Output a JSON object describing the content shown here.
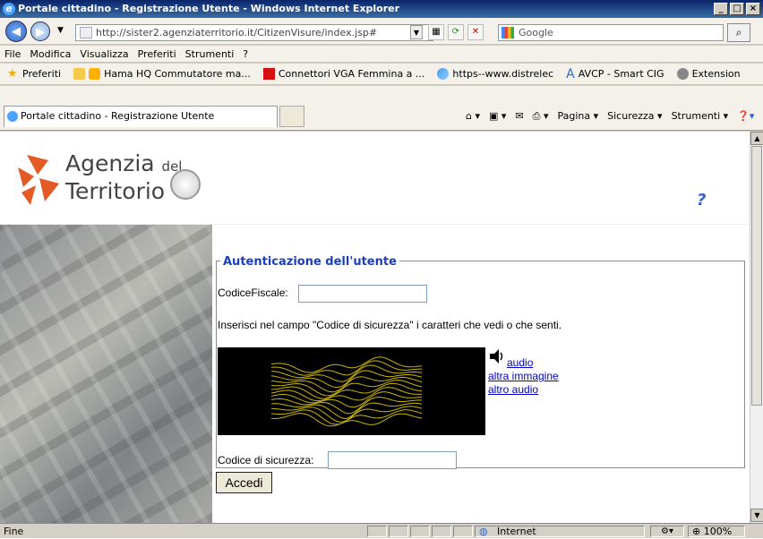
{
  "window": {
    "title": "Portale cittadino - Registrazione Utente - Windows Internet Explorer"
  },
  "address": {
    "url": "http://sister2.agenziaterritorio.it/CitizenVisure/index.jsp#"
  },
  "search": {
    "placeholder": "Google"
  },
  "menu": [
    "File",
    "Modifica",
    "Visualizza",
    "Preferiti",
    "Strumenti",
    "?"
  ],
  "favorites": {
    "label": "Preferiti",
    "items": [
      "Hama HQ Commutatore ma...",
      "Connettori VGA Femmina a ...",
      "https--www.distrelec",
      "AVCP - Smart CIG",
      "Extension"
    ]
  },
  "tab": {
    "title": "Portale cittadino - Registrazione Utente"
  },
  "commandbar": [
    "Pagina ▾",
    "Sicurezza ▾",
    "Strumenti ▾"
  ],
  "header": {
    "logo_line1": "Agenzia",
    "logo_del": "del",
    "logo_line2": "Territorio"
  },
  "form": {
    "legend": "Autenticazione dell'utente",
    "codicefiscale_label": "CodiceFiscale:",
    "codicefiscale_value": "",
    "instruction": "Inserisci nel campo \"Codice di sicurezza\" i caratteri che vedi o che senti.",
    "link_audio": "audio",
    "link_altra_immagine": "altra immagine",
    "link_altro_audio": "altro audio",
    "codice_label": "Codice di sicurezza:",
    "codice_value": "",
    "submit": "Accedi"
  },
  "status": {
    "text": "Fine",
    "zone": "Internet",
    "zoom": "100%"
  },
  "colors": {
    "link": "#0000cc",
    "legend": "#1a3fbf",
    "logo_orange": "#e35a24"
  }
}
